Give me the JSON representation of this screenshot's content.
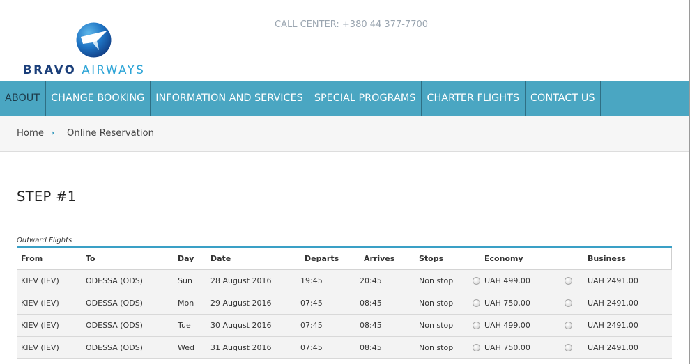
{
  "header": {
    "logo_word1": "BRAVO",
    "logo_word2": "AIRWAYS",
    "call_center": "CALL CENTER: +380 44 377-7700"
  },
  "nav": {
    "items": [
      {
        "label": "ABOUT"
      },
      {
        "label": "CHANGE BOOKING"
      },
      {
        "label": "INFORMATION AND SERVICES"
      },
      {
        "label": "SPECIAL PROGRAMS"
      },
      {
        "label": "CHARTER FLIGHTS"
      },
      {
        "label": "CONTACT US"
      }
    ]
  },
  "breadcrumb": {
    "home": "Home",
    "separator": "›",
    "current": "Online Reservation"
  },
  "step_title": "STEP #1",
  "section_label": "Outward Flights",
  "table": {
    "headers": {
      "from": "From",
      "to": "To",
      "day": "Day",
      "date": "Date",
      "departs": "Departs",
      "arrives": "Arrives",
      "stops": "Stops",
      "economy": "Economy",
      "business": "Business"
    },
    "rows": [
      {
        "from": "KIEV (IEV)",
        "to": "ODESSA (ODS)",
        "day": "Sun",
        "date": "28 August 2016",
        "departs": "19:45",
        "arrives": "20:45",
        "stops": "Non stop",
        "economy": "UAH 499.00",
        "business": "UAH 2491.00"
      },
      {
        "from": "KIEV (IEV)",
        "to": "ODESSA (ODS)",
        "day": "Mon",
        "date": "29 August 2016",
        "departs": "07:45",
        "arrives": "08:45",
        "stops": "Non stop",
        "economy": "UAH 750.00",
        "business": "UAH 2491.00"
      },
      {
        "from": "KIEV (IEV)",
        "to": "ODESSA (ODS)",
        "day": "Tue",
        "date": "30 August 2016",
        "departs": "07:45",
        "arrives": "08:45",
        "stops": "Non stop",
        "economy": "UAH 499.00",
        "business": "UAH 2491.00"
      },
      {
        "from": "KIEV (IEV)",
        "to": "ODESSA (ODS)",
        "day": "Wed",
        "date": "31 August 2016",
        "departs": "07:45",
        "arrives": "08:45",
        "stops": "Non stop",
        "economy": "UAH 750.00",
        "business": "UAH 2491.00"
      }
    ]
  },
  "colors": {
    "nav_bg": "#4aa6c2",
    "accent": "#3aa0c6",
    "brand_dark": "#1b3f7a",
    "brand_light": "#2aa3d6"
  }
}
